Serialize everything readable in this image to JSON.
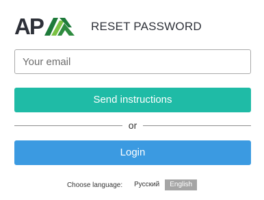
{
  "brand": {
    "logo_text": "AP",
    "logo_icon": "ap-logo-chevron-icon",
    "colors": {
      "logo_dark_green": "#1e7a3a",
      "logo_light_green": "#7ac143"
    }
  },
  "header": {
    "title": "RESET PASSWORD"
  },
  "form": {
    "email": {
      "value": "",
      "placeholder": "Your email"
    },
    "send_button": {
      "label": "Send instructions",
      "color": "#1fbba6"
    },
    "divider_text": "or",
    "login_button": {
      "label": "Login",
      "color": "#3b9ae1"
    }
  },
  "language": {
    "label": "Choose language:",
    "options": [
      {
        "label": "Русский",
        "selected": false
      },
      {
        "label": "English",
        "selected": true
      }
    ]
  }
}
